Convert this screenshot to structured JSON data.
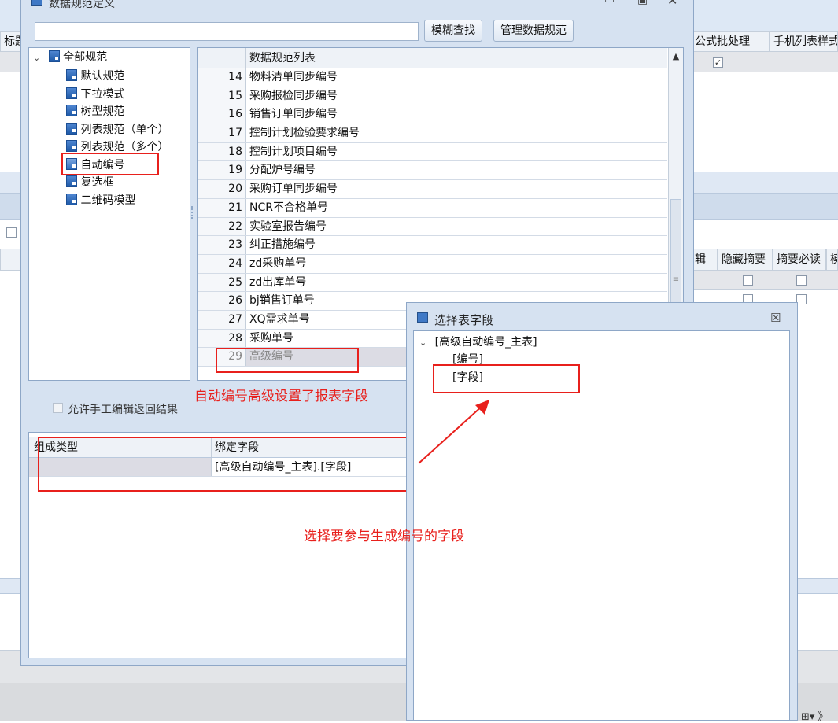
{
  "background": {
    "col_headers_top": [
      "标题",
      "公式批处理",
      "手机列表样式"
    ],
    "col_headers_mid": [
      "辑",
      "隐藏摘要",
      "摘要必读",
      "模"
    ],
    "bottom_glyph": "⊞▾ 》"
  },
  "dialog": {
    "title": "数据规范定义",
    "search_value": "",
    "fuzzy_btn": "模糊查找",
    "manage_btn": "管理数据规范",
    "tree_root": "全部规范",
    "tree_items": [
      "默认规范",
      "下拉模式",
      "树型规范",
      "列表规范（单个）",
      "列表规范（多个）",
      "自动编号",
      "复选框",
      "二维码模型"
    ],
    "list_header": "数据规范列表",
    "list_rows": [
      {
        "n": "14",
        "t": "物料清单同步编号"
      },
      {
        "n": "15",
        "t": "采购报检同步编号"
      },
      {
        "n": "16",
        "t": "销售订单同步编号"
      },
      {
        "n": "17",
        "t": "控制计划检验要求编号"
      },
      {
        "n": "18",
        "t": "控制计划项目编号"
      },
      {
        "n": "19",
        "t": "分配炉号编号"
      },
      {
        "n": "20",
        "t": "采购订单同步编号"
      },
      {
        "n": "21",
        "t": "NCR不合格单号"
      },
      {
        "n": "22",
        "t": "实验室报告编号"
      },
      {
        "n": "23",
        "t": "纠正措施编号"
      },
      {
        "n": "24",
        "t": "zd采购单号"
      },
      {
        "n": "25",
        "t": "zd出库单号"
      },
      {
        "n": "26",
        "t": "bj销售订单号"
      },
      {
        "n": "27",
        "t": "XQ需求单号"
      },
      {
        "n": "28",
        "t": "采购单号"
      },
      {
        "n": "29",
        "t": "高级编号"
      }
    ],
    "allow_manual_label": "允许手工编辑返回结果",
    "grid_col1": "组成类型",
    "grid_col2": "绑定字段",
    "grid_row_col1": "",
    "grid_row_col2": "[高级自动编号_主表].[字段]"
  },
  "popup": {
    "title": "选择表字段",
    "root": "[高级自动编号_主表]",
    "children": [
      "[编号]",
      "[字段]"
    ]
  },
  "annotations": {
    "a1": "自动编号高级设置了报表字段",
    "a2": "选择要参与生成编号的字段"
  },
  "colors": {
    "annotation_red": "#e8201c",
    "dialog_bg": "#d6e2f1",
    "selected_row": "#dcdce4"
  }
}
